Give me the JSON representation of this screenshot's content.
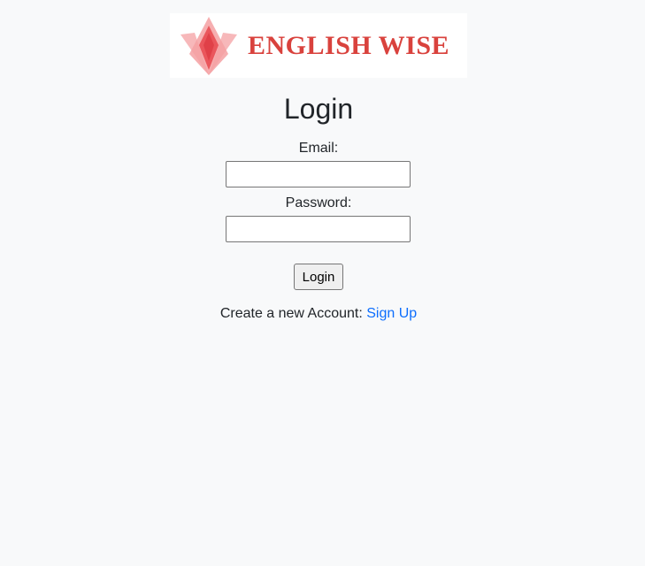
{
  "brand": {
    "name": "ENGLISH WISE",
    "logo_icon": "lotus-icon",
    "color": "#d9423d"
  },
  "login": {
    "title": "Login",
    "email_label": "Email:",
    "email_value": "",
    "password_label": "Password:",
    "password_value": "",
    "submit_label": "Login"
  },
  "signup": {
    "prompt": "Create a new Account:",
    "link_label": "Sign Up",
    "link_color": "#0d6efd"
  }
}
